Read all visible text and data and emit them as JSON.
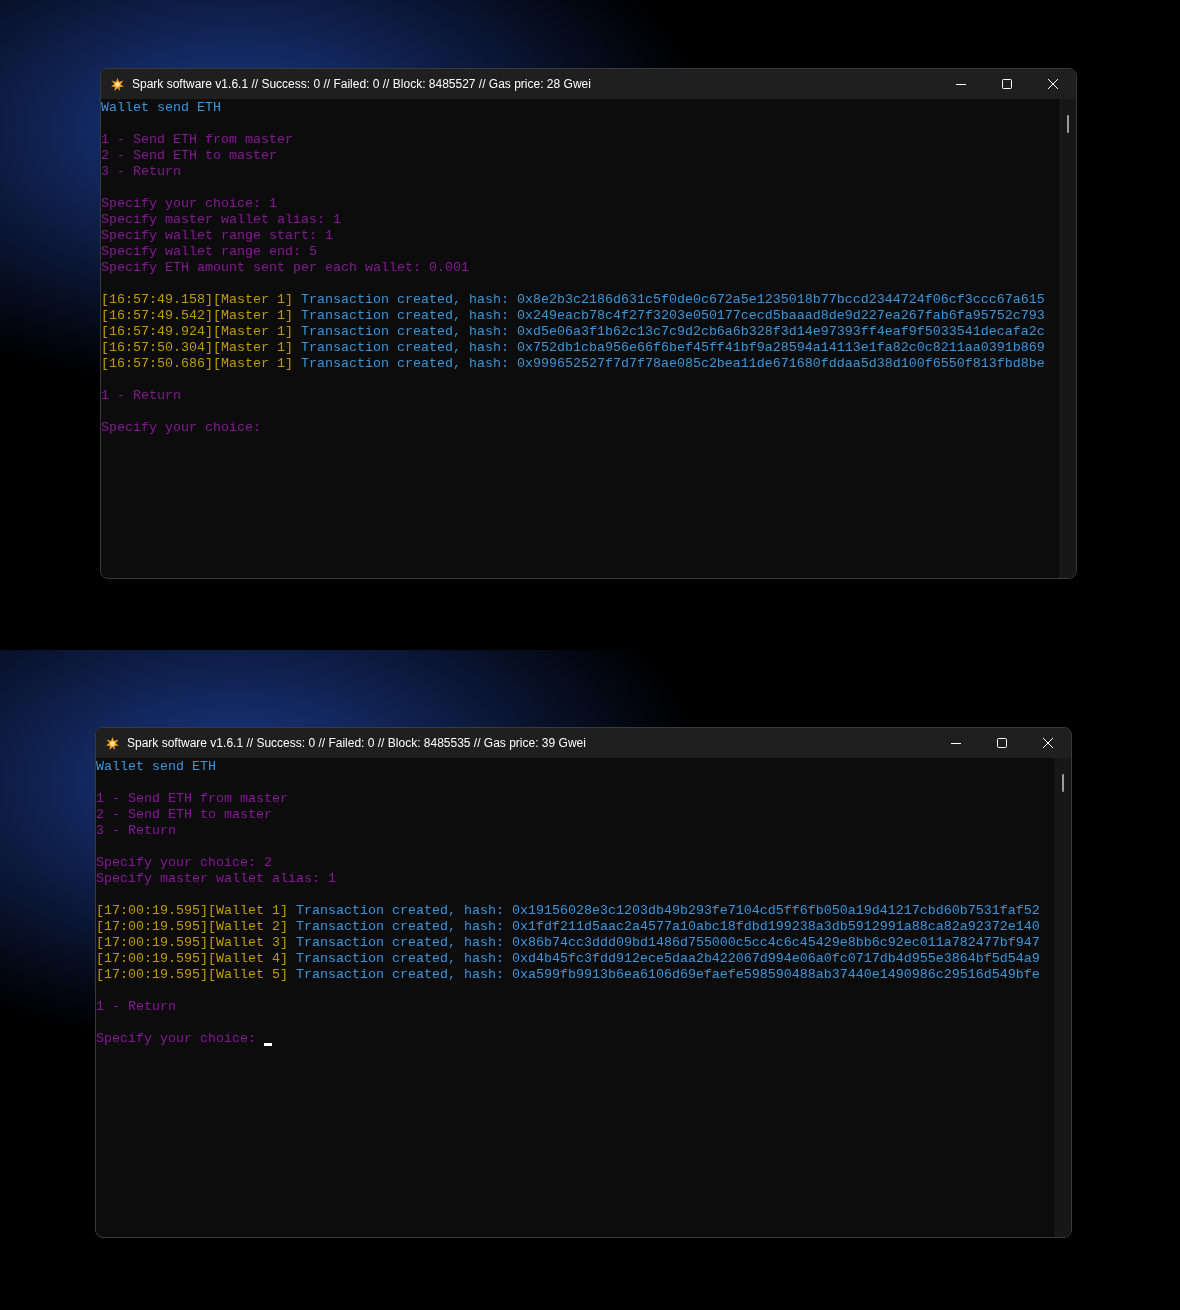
{
  "windows": [
    {
      "title": "Spark software v1.6.1 // Success: 0 // Failed: 0 // Block: 8485527 // Gas price: 28 Gwei",
      "cursor": false,
      "lines": [
        {
          "kind": "heading",
          "text": "Wallet send ETH"
        },
        {
          "kind": "blank"
        },
        {
          "kind": "menu",
          "text": "1 - Send ETH from master"
        },
        {
          "kind": "menu",
          "text": "2 - Send ETH to master"
        },
        {
          "kind": "menu",
          "text": "3 - Return"
        },
        {
          "kind": "blank"
        },
        {
          "kind": "menu",
          "text": "Specify your choice: 1"
        },
        {
          "kind": "menu",
          "text": "Specify master wallet alias: 1"
        },
        {
          "kind": "menu",
          "text": "Specify wallet range start: 1"
        },
        {
          "kind": "menu",
          "text": "Specify wallet range end: 5"
        },
        {
          "kind": "menu",
          "text": "Specify ETH amount sent per each wallet: 0.001"
        },
        {
          "kind": "blank"
        },
        {
          "kind": "log",
          "time": "[16:57:49.158]",
          "source": "[Master 1]",
          "message": "Transaction created, hash: 0x8e2b3c2186d631c5f0de0c672a5e1235018b77bccd2344724f06cf3ccc67a615"
        },
        {
          "kind": "log",
          "time": "[16:57:49.542]",
          "source": "[Master 1]",
          "message": "Transaction created, hash: 0x249eacb78c4f27f3203e050177cecd5baaad8de9d227ea267fab6fa95752c793"
        },
        {
          "kind": "log",
          "time": "[16:57:49.924]",
          "source": "[Master 1]",
          "message": "Transaction created, hash: 0xd5e06a3f1b62c13c7c9d2cb6a6b328f3d14e97393ff4eaf9f5033541decafa2c"
        },
        {
          "kind": "log",
          "time": "[16:57:50.304]",
          "source": "[Master 1]",
          "message": "Transaction created, hash: 0x752db1cba956e66f6bef45ff41bf9a28594a14113e1fa82c0c8211aa0391b869"
        },
        {
          "kind": "log",
          "time": "[16:57:50.686]",
          "source": "[Master 1]",
          "message": "Transaction created, hash: 0x999652527f7d7f78ae085c2bea11de671680fddaa5d38d100f6550f813fbd8be"
        },
        {
          "kind": "blank"
        },
        {
          "kind": "menu",
          "text": "1 - Return"
        },
        {
          "kind": "blank"
        },
        {
          "kind": "menu",
          "text": "Specify your choice:"
        }
      ]
    },
    {
      "title": "Spark software v1.6.1 // Success: 0 // Failed: 0 // Block: 8485535 // Gas price: 39 Gwei",
      "cursor": true,
      "lines": [
        {
          "kind": "heading",
          "text": "Wallet send ETH"
        },
        {
          "kind": "blank"
        },
        {
          "kind": "menu",
          "text": "1 - Send ETH from master"
        },
        {
          "kind": "menu",
          "text": "2 - Send ETH to master"
        },
        {
          "kind": "menu",
          "text": "3 - Return"
        },
        {
          "kind": "blank"
        },
        {
          "kind": "menu",
          "text": "Specify your choice: 2"
        },
        {
          "kind": "menu",
          "text": "Specify master wallet alias: 1"
        },
        {
          "kind": "blank"
        },
        {
          "kind": "log",
          "time": "[17:00:19.595]",
          "source": "[Wallet 1]",
          "message": "Transaction created, hash: 0x19156028e3c1203db49b293fe7104cd5ff6fb050a19d41217cbd60b7531faf52"
        },
        {
          "kind": "log",
          "time": "[17:00:19.595]",
          "source": "[Wallet 2]",
          "message": "Transaction created, hash: 0x1fdf211d5aac2a4577a10abc18fdbd199238a3db5912991a88ca82a92372e140"
        },
        {
          "kind": "log",
          "time": "[17:00:19.595]",
          "source": "[Wallet 3]",
          "message": "Transaction created, hash: 0x86b74cc3ddd09bd1486d755000c5cc4c6c45429e8bb6c92ec011a782477bf947"
        },
        {
          "kind": "log",
          "time": "[17:00:19.595]",
          "source": "[Wallet 4]",
          "message": "Transaction created, hash: 0xd4b45fc3fdd912ece5daa2b422067d994e06a0fc0717db4d955e3864bf5d54a9"
        },
        {
          "kind": "log",
          "time": "[17:00:19.595]",
          "source": "[Wallet 5]",
          "message": "Transaction created, hash: 0xa599fb9913b6ea6106d69efaefe598590488ab37440e1490986c29516d549bfe"
        },
        {
          "kind": "blank"
        },
        {
          "kind": "menu",
          "text": "1 - Return"
        },
        {
          "kind": "blank"
        },
        {
          "kind": "menu",
          "text": "Specify your choice:"
        }
      ]
    }
  ]
}
